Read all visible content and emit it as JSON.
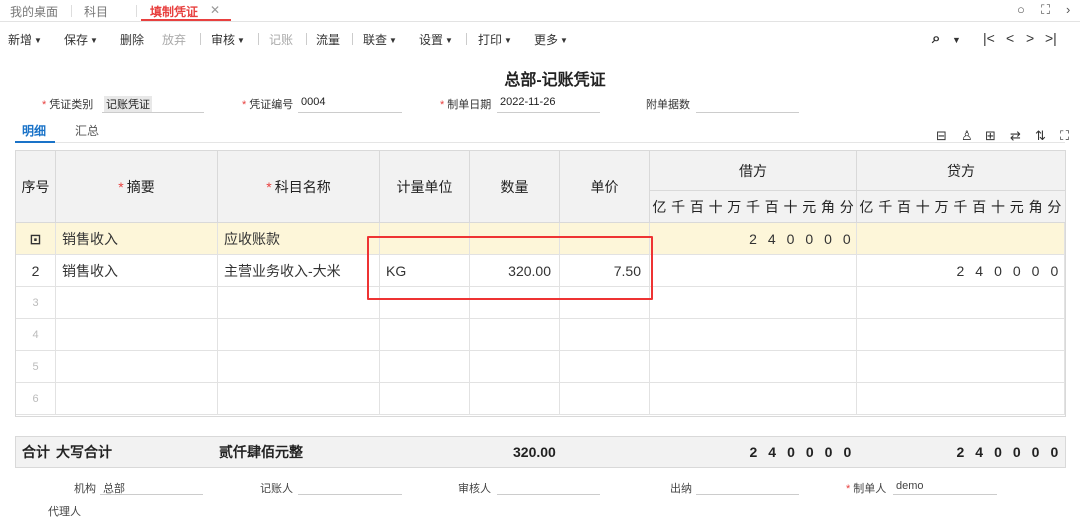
{
  "tabs": [
    {
      "label": "我的桌面"
    },
    {
      "label": "科目"
    },
    {
      "label": "填制凭证",
      "close": "✕"
    }
  ],
  "window_controls": [
    "○",
    "⛶",
    "›"
  ],
  "toolbar": {
    "new": "新增",
    "save": "保存",
    "delete": "删除",
    "abandon": "放弃",
    "audit": "审核",
    "post": "记账",
    "flow": "流量",
    "query": "联查",
    "settings": "设置",
    "print": "打印",
    "more": "更多"
  },
  "nav_icons": {
    "search": "⌕",
    "first": "|<",
    "prev": "<",
    "next": ">",
    "last": ">|"
  },
  "voucher": {
    "title": "总部-记账凭证",
    "type_label": "凭证类别",
    "type_value": "记账凭证",
    "number_label": "凭证编号",
    "number_value": "0004",
    "date_label": "制单日期",
    "date_value": "2022-11-26",
    "attachments_label": "附单据数",
    "attachments_value": ""
  },
  "subtabs": {
    "detail": "明细",
    "summary": "汇总"
  },
  "grid": {
    "headers": {
      "seq": "序号",
      "summary": "摘要",
      "account": "科目名称",
      "unit": "计量单位",
      "qty": "数量",
      "price": "单价",
      "debit": "借方",
      "credit": "贷方"
    },
    "digit_headers": [
      "亿",
      "千",
      "百",
      "十",
      "万",
      "千",
      "百",
      "十",
      "元",
      "角",
      "分"
    ],
    "rows": [
      {
        "seq": "⊡",
        "summary": "销售收入",
        "account": "应收账款",
        "unit": "",
        "qty": "",
        "price": "",
        "debit": "240000",
        "credit": ""
      },
      {
        "seq": "2",
        "summary": "销售收入",
        "account": "主营业务收入-大米",
        "unit": "KG",
        "qty": "320.00",
        "price": "7.50",
        "debit": "",
        "credit": "240000"
      },
      {
        "seq": "3",
        "summary": "",
        "account": "",
        "unit": "",
        "qty": "",
        "price": "",
        "debit": "",
        "credit": ""
      },
      {
        "seq": "4",
        "summary": "",
        "account": "",
        "unit": "",
        "qty": "",
        "price": "",
        "debit": "",
        "credit": ""
      },
      {
        "seq": "5",
        "summary": "",
        "account": "",
        "unit": "",
        "qty": "",
        "price": "",
        "debit": "",
        "credit": ""
      },
      {
        "seq": "6",
        "summary": "",
        "account": "",
        "unit": "",
        "qty": "",
        "price": "",
        "debit": "",
        "credit": ""
      }
    ]
  },
  "totals": {
    "label": "合计",
    "caps_label": "大写合计",
    "caps_value": "贰仟肆佰元整",
    "qty": "320.00",
    "debit": "240000",
    "credit": "240000"
  },
  "footer": {
    "org_label": "机构",
    "org_value": "总部",
    "poster_label": "记账人",
    "auditor_label": "审核人",
    "cashier_label": "出纳",
    "maker_label": "制单人",
    "maker_value": "demo",
    "agent_label": "代理人"
  },
  "colors": {
    "accent": "#e8403f",
    "link": "#1a73c8",
    "row_highlight": "#fdf6d9"
  }
}
